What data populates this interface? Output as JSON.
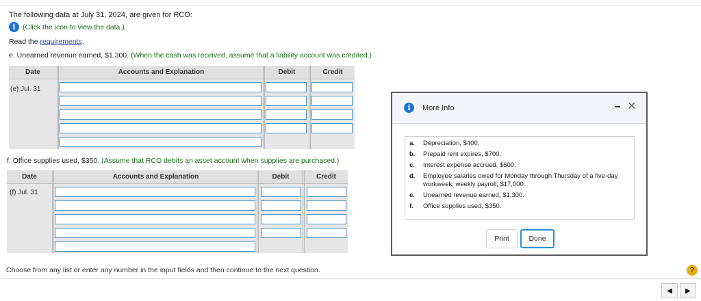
{
  "intro": "The following data at July 31, 2024, are given for RCO:",
  "info_link": "(Click the icon to view the data.)",
  "read": {
    "prefix": "Read the ",
    "link": "requirements",
    "suffix": "."
  },
  "question_e": {
    "text": "e. Unearned revenue earned, $1,300.",
    "hint": "(When the cash was received, assume that a liability account was credited.)"
  },
  "question_f": {
    "text": "f. Office supplies used, $350.",
    "hint": "(Assume that RCO debits an asset account when supplies are purchased.)"
  },
  "journal_headers": {
    "date": "Date",
    "accounts": "Accounts and Explanation",
    "debit": "Debit",
    "credit": "Credit"
  },
  "journal_e": {
    "date": "(e) Jul. 31"
  },
  "journal_f": {
    "date": "(f) Jul. 31"
  },
  "instruction": "Choose from any list or enter any number in the input fields and then continue to the next question.",
  "help": "?",
  "modal": {
    "title": "More Info",
    "items": [
      {
        "letter": "a.",
        "text": "Depreciation, $400."
      },
      {
        "letter": "b.",
        "text": "Prepaid rent expires, $700."
      },
      {
        "letter": "c.",
        "text": "Interest expense accrued, $600."
      },
      {
        "letter": "d.",
        "text": "Employee salaries owed for Monday through Thursday of a five-day workweek; weekly payroll, $17,000."
      },
      {
        "letter": "e.",
        "text": "Unearned revenue earned, $1,300."
      },
      {
        "letter": "f.",
        "text": "Office supplies used, $350."
      }
    ],
    "print": "Print",
    "done": "Done"
  },
  "icons": {
    "info": "info-icon",
    "help": "help-icon",
    "minimize": "minimize-icon",
    "close": "close-icon",
    "prev": "arrow-left-icon",
    "next": "arrow-right-icon"
  }
}
